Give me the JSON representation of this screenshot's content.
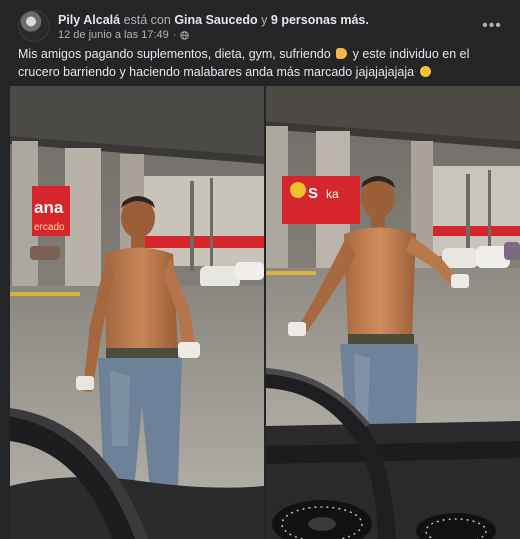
{
  "post": {
    "author": "Pily Alcalá",
    "with_text": "está con",
    "tagged": "Gina Saucedo",
    "and_text": "y",
    "others": "9 personas más.",
    "date": "12 de junio a las 17:49",
    "separator": "·",
    "caption_part1": "Mis amigos pagando suplementos, dieta, gym, sufriendo",
    "caption_part2": "y este individuo en el crucero barriendo y haciendo malabares anda más  marcado jajajajajaja",
    "more_options": "•••",
    "icons": [
      "avatar",
      "globe-icon",
      "more-options-icon",
      "flexed-biceps-emoji",
      "laughing-emoji"
    ]
  },
  "photos": [
    {
      "sign_text": "ana",
      "sign_sub": "ercado"
    },
    {
      "sign_text": "S",
      "sign_sub": "ka"
    }
  ],
  "colors": {
    "background": "#242526",
    "text_primary": "#e4e6eb",
    "text_secondary": "#b0b3b8",
    "sign_red": "#d7262b"
  }
}
